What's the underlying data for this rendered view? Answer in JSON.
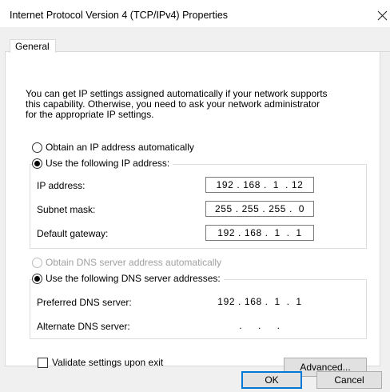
{
  "window": {
    "title": "Internet Protocol Version 4 (TCP/IPv4) Properties",
    "close_icon": "close-icon"
  },
  "tabs": [
    {
      "label": "General",
      "selected": true
    }
  ],
  "info_text": "You can get IP settings assigned automatically if your network supports\nthis capability. Otherwise, you need to ask your network administrator\nfor the appropriate IP settings.",
  "ip_mode": {
    "auto": {
      "label": "Obtain an IP address automatically",
      "checked": false
    },
    "manual": {
      "label": "Use the following IP address:",
      "checked": true
    }
  },
  "ip_fields": [
    {
      "label": "IP address:",
      "value": "192 . 168 .  1  . 12"
    },
    {
      "label": "Subnet mask:",
      "value": "255 . 255 . 255 .  0"
    },
    {
      "label": "Default gateway:",
      "value": "192 . 168 .  1  .  1"
    }
  ],
  "dns_mode": {
    "auto": {
      "label": "Obtain DNS server address automatically",
      "checked": false,
      "disabled": true
    },
    "manual": {
      "label": "Use the following DNS server addresses:",
      "checked": true
    }
  },
  "dns_fields": [
    {
      "label": "Preferred DNS server:",
      "value": "192 . 168 .  1  .  1"
    },
    {
      "label": "Alternate DNS server:",
      "value": "  .     .     .  "
    }
  ],
  "validate": {
    "label": "Validate settings upon exit",
    "checked": false
  },
  "buttons": {
    "advanced": "Advanced...",
    "ok": "OK",
    "cancel": "Cancel"
  },
  "colors": {
    "accent": "#0078d7",
    "dialog_bg": "#f0f0f0",
    "disabled_text": "#a0a0a0"
  }
}
